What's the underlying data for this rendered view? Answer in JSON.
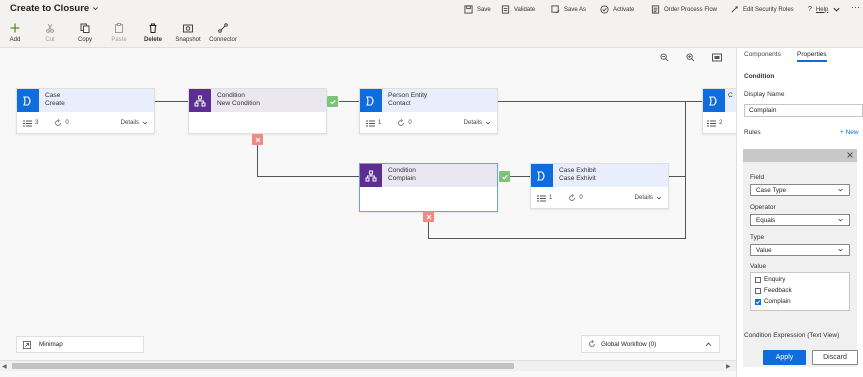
{
  "header": {
    "title": "Create to Closure",
    "commands": [
      {
        "label": "Save",
        "icon": "save-icon"
      },
      {
        "label": "Validate",
        "icon": "validate-icon"
      },
      {
        "label": "Save As",
        "icon": "save-as-icon"
      },
      {
        "label": "Activate",
        "icon": "activate-icon"
      },
      {
        "label": "Order Process Flow",
        "icon": "order-icon"
      },
      {
        "label": "Edit Security Roles",
        "icon": "security-icon"
      },
      {
        "label": "Help",
        "icon": "help-icon"
      }
    ],
    "more": "···"
  },
  "toolbar": [
    {
      "label": "Add",
      "icon": "plus-icon",
      "enabled": true
    },
    {
      "label": "Cut",
      "icon": "scissors-icon",
      "enabled": false
    },
    {
      "label": "Copy",
      "icon": "copy-icon",
      "enabled": true
    },
    {
      "label": "Paste",
      "icon": "paste-icon",
      "enabled": false
    },
    {
      "label": "Delete",
      "icon": "trash-icon",
      "enabled": true
    },
    {
      "label": "Snapshot",
      "icon": "snapshot-icon",
      "enabled": true
    },
    {
      "label": "Connector",
      "icon": "connector-icon",
      "enabled": true
    }
  ],
  "canvas": {
    "nodes": {
      "case": {
        "type": "Case",
        "name": "Create",
        "steps": "3",
        "count": "0",
        "details": "Details"
      },
      "condition1": {
        "type": "Condition",
        "name": "New Condition"
      },
      "person": {
        "type": "Person Entity",
        "name": "Contact",
        "steps": "1",
        "count": "0",
        "details": "Details"
      },
      "edge_node": {
        "type": "C",
        "steps": "2"
      },
      "condition2": {
        "type": "Condition",
        "name": "Complain"
      },
      "exhibit": {
        "type": "Case Exhibit",
        "name": "Case Exhivit",
        "steps": "1",
        "count": "0",
        "details": "Details"
      }
    },
    "minimap_label": "Minimap",
    "global_workflow_label": "Global Workflow (0)"
  },
  "panel": {
    "tabs": [
      "Components",
      "Properties"
    ],
    "active_tab": "Properties",
    "section_title": "Condition",
    "display_name_label": "Display Name",
    "display_name_value": "Complain",
    "rules_label": "Rules",
    "new_label": "+ New",
    "field_label": "Field",
    "field_value": "Case Type",
    "operator_label": "Operator",
    "operator_value": "Equals",
    "type_label": "Type",
    "type_value": "Value",
    "value_label": "Value",
    "options": [
      {
        "label": "Enquiry",
        "checked": false
      },
      {
        "label": "Feedback",
        "checked": false
      },
      {
        "label": "Complain",
        "checked": true
      }
    ],
    "expression_label": "Condition Expression (Text View)",
    "apply_label": "Apply",
    "discard_label": "Discard"
  },
  "colors": {
    "accent": "#0f6cdd",
    "condition": "#5c2e91",
    "yes": "#7cc47a",
    "no": "#f08a80"
  }
}
